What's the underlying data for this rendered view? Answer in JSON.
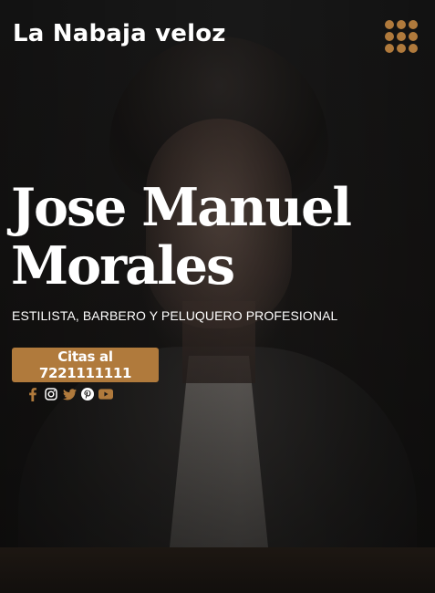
{
  "header": {
    "brand": "La Nabaja veloz",
    "menu_icon": "grid-dots-icon"
  },
  "hero": {
    "name_line1": "Jose Manuel",
    "name_line2": "Morales",
    "tagline": "ESTILISTA, BARBERO Y PELUQUERO PROFESIONAL",
    "cta_label": "Citas al 7221111111"
  },
  "social": [
    {
      "name": "facebook-icon",
      "color": "#b07a3c"
    },
    {
      "name": "instagram-icon",
      "color": "#ffffff"
    },
    {
      "name": "twitter-icon",
      "color": "#b07a3c"
    },
    {
      "name": "pinterest-icon",
      "color": "#ffffff"
    },
    {
      "name": "youtube-icon",
      "color": "#b07a3c"
    }
  ],
  "colors": {
    "accent": "#b07a3c",
    "text": "#ffffff",
    "background": "#121212"
  }
}
